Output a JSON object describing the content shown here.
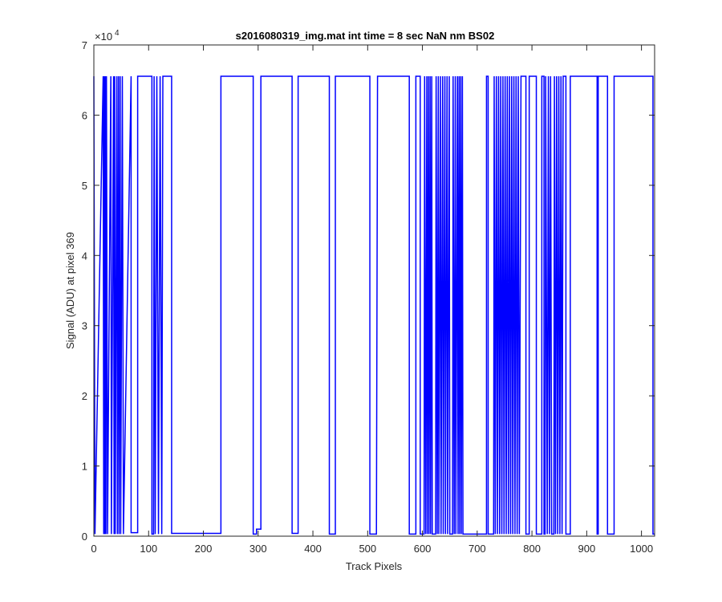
{
  "chart_data": {
    "type": "line",
    "title": "s2016080319_img.mat int time = 8 sec  NaN nm BS02",
    "xlabel": "Track Pixels",
    "ylabel": "Signal (ADU) at pixel 369",
    "xlim": [
      0,
      1024
    ],
    "ylim": [
      0,
      70000
    ],
    "xticks": [
      0,
      100,
      200,
      300,
      400,
      500,
      600,
      700,
      800,
      900,
      1000
    ],
    "yticks": [
      0,
      10000,
      20000,
      30000,
      40000,
      50000,
      60000,
      70000
    ],
    "ytick_labels": [
      "0",
      "1",
      "2",
      "3",
      "4",
      "5",
      "6",
      "7"
    ],
    "y_exponent_label": "×10",
    "y_exponent_power": "4",
    "grid": false,
    "series_color": "#0000ff",
    "saturation_level": 65535,
    "low_level": 300,
    "series": [
      {
        "values_description_free": true,
        "step_segments": [
          [
            0,
            1,
            65535
          ],
          [
            1,
            2,
            300
          ],
          [
            2,
            17,
            65535
          ],
          [
            17,
            18,
            300
          ],
          [
            18,
            19,
            65535
          ],
          [
            19,
            20,
            300
          ],
          [
            20,
            21,
            65535
          ],
          [
            21,
            22,
            300
          ],
          [
            22,
            23,
            65535
          ],
          [
            23,
            24,
            300
          ],
          [
            24,
            25,
            65535
          ],
          [
            25,
            31,
            300
          ],
          [
            31,
            32,
            65535
          ],
          [
            32,
            36,
            300
          ],
          [
            36,
            37,
            65535
          ],
          [
            37,
            38,
            300
          ],
          [
            38,
            39,
            65535
          ],
          [
            39,
            42,
            300
          ],
          [
            42,
            43,
            65535
          ],
          [
            43,
            45,
            300
          ],
          [
            45,
            46,
            65535
          ],
          [
            46,
            48,
            300
          ],
          [
            48,
            49,
            65535
          ],
          [
            49,
            52,
            300
          ],
          [
            52,
            53,
            65535
          ],
          [
            53,
            54,
            300
          ],
          [
            54,
            68,
            65535
          ],
          [
            68,
            80,
            500
          ],
          [
            80,
            106,
            65535
          ],
          [
            106,
            109,
            300
          ],
          [
            109,
            110,
            65535
          ],
          [
            110,
            112,
            300
          ],
          [
            112,
            115,
            65535
          ],
          [
            115,
            118,
            300
          ],
          [
            118,
            121,
            65535
          ],
          [
            121,
            124,
            300
          ],
          [
            124,
            142,
            65535
          ],
          [
            142,
            232,
            400
          ],
          [
            232,
            291,
            65535
          ],
          [
            291,
            297,
            300
          ],
          [
            297,
            305,
            1000
          ],
          [
            305,
            362,
            65535
          ],
          [
            362,
            373,
            400
          ],
          [
            373,
            430,
            65535
          ],
          [
            430,
            439,
            300
          ],
          [
            439,
            441,
            300
          ],
          [
            441,
            444,
            700
          ],
          [
            444,
            450,
            400
          ],
          [
            450,
            505,
            300
          ],
          [
            505,
            516,
            65535
          ],
          [
            516,
            518,
            500
          ],
          [
            518,
            509,
            500
          ]
        ]
      }
    ],
    "profile": [
      [
        0,
        65535
      ],
      [
        2,
        300
      ],
      [
        17,
        65535
      ],
      [
        18,
        300
      ],
      [
        19,
        65535
      ],
      [
        20,
        300
      ],
      [
        21,
        65535
      ],
      [
        22,
        300
      ],
      [
        23,
        65535
      ],
      [
        25,
        300
      ],
      [
        31,
        65535
      ],
      [
        32,
        300
      ],
      [
        36,
        65535
      ],
      [
        37,
        300
      ],
      [
        38,
        65535
      ],
      [
        39,
        300
      ],
      [
        42,
        65535
      ],
      [
        43,
        300
      ],
      [
        45,
        65535
      ],
      [
        46,
        300
      ],
      [
        48,
        65535
      ],
      [
        49,
        300
      ],
      [
        52,
        65535
      ],
      [
        54,
        300
      ],
      [
        68,
        65535
      ],
      [
        68,
        500
      ],
      [
        80,
        500
      ],
      [
        80,
        65535
      ],
      [
        106,
        65535
      ],
      [
        106,
        300
      ],
      [
        109,
        300
      ],
      [
        110,
        65535
      ],
      [
        112,
        300
      ],
      [
        115,
        65535
      ],
      [
        118,
        300
      ],
      [
        121,
        65535
      ],
      [
        124,
        300
      ],
      [
        126,
        65535
      ],
      [
        142,
        65535
      ],
      [
        142,
        400
      ],
      [
        232,
        400
      ],
      [
        232,
        65535
      ],
      [
        291,
        65535
      ],
      [
        291,
        300
      ],
      [
        297,
        300
      ],
      [
        297,
        1000
      ],
      [
        305,
        1000
      ],
      [
        305,
        65535
      ],
      [
        362,
        65535
      ],
      [
        362,
        400
      ],
      [
        373,
        400
      ],
      [
        373,
        65535
      ],
      [
        430,
        65535
      ],
      [
        430,
        300
      ],
      [
        441,
        300
      ],
      [
        441,
        65535
      ],
      [
        504,
        65535
      ],
      [
        504,
        300
      ],
      [
        516,
        300
      ],
      [
        516,
        500
      ],
      [
        518,
        65535
      ],
      [
        576,
        65535
      ],
      [
        576,
        300
      ],
      [
        588,
        300
      ],
      [
        588,
        65535
      ],
      [
        596,
        65535
      ],
      [
        596,
        300
      ],
      [
        603,
        300
      ],
      [
        604,
        65535
      ],
      [
        606,
        300
      ],
      [
        608,
        65535
      ],
      [
        609,
        300
      ],
      [
        611,
        65535
      ],
      [
        612,
        300
      ],
      [
        614,
        65535
      ],
      [
        615,
        300
      ],
      [
        617,
        65535
      ],
      [
        618,
        300
      ],
      [
        624,
        300
      ],
      [
        625,
        65535
      ],
      [
        627,
        300
      ],
      [
        629,
        65535
      ],
      [
        630,
        300
      ],
      [
        633,
        65535
      ],
      [
        634,
        300
      ],
      [
        637,
        65535
      ],
      [
        638,
        300
      ],
      [
        641,
        65535
      ],
      [
        642,
        300
      ],
      [
        645,
        65535
      ],
      [
        646,
        300
      ],
      [
        649,
        65535
      ],
      [
        650,
        300
      ],
      [
        655,
        300
      ],
      [
        656,
        65535
      ],
      [
        658,
        300
      ],
      [
        660,
        65535
      ],
      [
        661,
        300
      ],
      [
        664,
        65535
      ],
      [
        665,
        300
      ],
      [
        667,
        65535
      ],
      [
        668,
        300
      ],
      [
        670,
        65535
      ],
      [
        671,
        300
      ],
      [
        673,
        65535
      ],
      [
        674,
        300
      ],
      [
        717,
        300
      ],
      [
        717,
        65535
      ],
      [
        720,
        65535
      ],
      [
        720,
        300
      ],
      [
        730,
        300
      ],
      [
        731,
        65535
      ],
      [
        733,
        300
      ],
      [
        735,
        65535
      ],
      [
        737,
        300
      ],
      [
        739,
        65535
      ],
      [
        741,
        300
      ],
      [
        743,
        65535
      ],
      [
        745,
        300
      ],
      [
        747,
        65535
      ],
      [
        749,
        300
      ],
      [
        751,
        65535
      ],
      [
        753,
        300
      ],
      [
        755,
        65535
      ],
      [
        757,
        300
      ],
      [
        759,
        65535
      ],
      [
        761,
        300
      ],
      [
        763,
        65535
      ],
      [
        765,
        300
      ],
      [
        767,
        65535
      ],
      [
        769,
        300
      ],
      [
        771,
        65535
      ],
      [
        773,
        300
      ],
      [
        775,
        65535
      ],
      [
        777,
        300
      ],
      [
        780,
        65535
      ],
      [
        789,
        65535
      ],
      [
        789,
        300
      ],
      [
        795,
        300
      ],
      [
        795,
        65535
      ],
      [
        808,
        65535
      ],
      [
        808,
        300
      ],
      [
        818,
        300
      ],
      [
        818,
        65535
      ],
      [
        822,
        65535
      ],
      [
        822,
        300
      ],
      [
        824,
        300
      ],
      [
        825,
        65535
      ],
      [
        828,
        300
      ],
      [
        830,
        65535
      ],
      [
        832,
        300
      ],
      [
        834,
        65535
      ],
      [
        836,
        300
      ],
      [
        840,
        300
      ],
      [
        841,
        65535
      ],
      [
        843,
        300
      ],
      [
        845,
        65535
      ],
      [
        847,
        300
      ],
      [
        849,
        65535
      ],
      [
        851,
        300
      ],
      [
        853,
        65535
      ],
      [
        855,
        300
      ],
      [
        857,
        65535
      ],
      [
        862,
        65535
      ],
      [
        862,
        300
      ],
      [
        870,
        300
      ],
      [
        870,
        65535
      ],
      [
        919,
        65535
      ],
      [
        919,
        300
      ],
      [
        921,
        300
      ],
      [
        921,
        65535
      ],
      [
        938,
        65535
      ],
      [
        938,
        300
      ],
      [
        950,
        300
      ],
      [
        950,
        65535
      ],
      [
        1021,
        65535
      ],
      [
        1021,
        300
      ],
      [
        1024,
        300
      ]
    ]
  }
}
